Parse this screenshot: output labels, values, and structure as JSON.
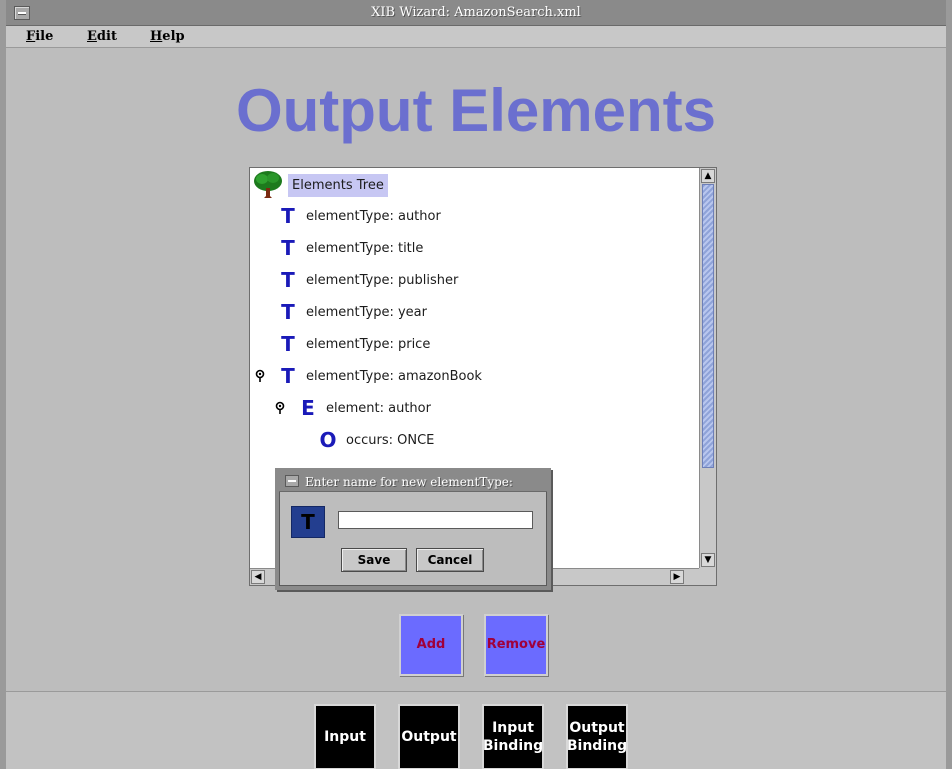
{
  "window": {
    "title": "XIB Wizard: AmazonSearch.xml"
  },
  "menubar": {
    "items": [
      {
        "mnemonic": "F",
        "rest": "ile"
      },
      {
        "mnemonic": "E",
        "rest": "dit"
      },
      {
        "mnemonic": "H",
        "rest": "elp"
      }
    ]
  },
  "page": {
    "title": "Output Elements"
  },
  "tree": {
    "root_label": "Elements Tree",
    "root_icon": "tree-icon",
    "rows": [
      {
        "glyph": "T",
        "label": "elementType: author"
      },
      {
        "glyph": "T",
        "label": "elementType: title"
      },
      {
        "glyph": "T",
        "label": "elementType: publisher"
      },
      {
        "glyph": "T",
        "label": "elementType: year"
      },
      {
        "glyph": "T",
        "label": "elementType: price"
      },
      {
        "glyph": "T",
        "label": "elementType: amazonBook"
      },
      {
        "glyph": "E",
        "label": "element: author"
      },
      {
        "glyph": "O",
        "label": "occurs: ONCE"
      }
    ],
    "glyph_color": "#1a1ab8",
    "selection_color": "#c7c7f3"
  },
  "dialog": {
    "title": "Enter name for new elementType:",
    "icon_glyph": "T",
    "input_value": "",
    "save_label": "Save",
    "cancel_label": "Cancel"
  },
  "actions": {
    "add_label": "Add",
    "remove_label": "Remove"
  },
  "nav": {
    "input_label": "Input",
    "output_label": "Output",
    "input_binding_label": "Input\nBinding",
    "output_binding_label": "Output\nBinding"
  },
  "colors": {
    "title": "#6b6fcf",
    "action_button": "#6b6bff",
    "action_text": "#a0003a",
    "nav_button": "#000000"
  }
}
